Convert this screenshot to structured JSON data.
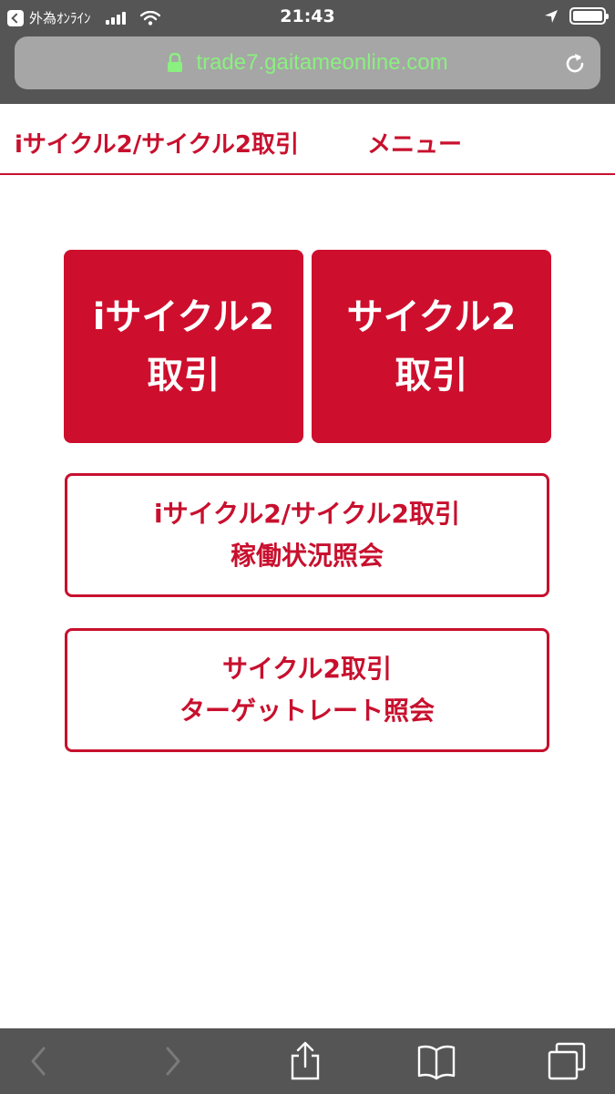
{
  "status_bar": {
    "carrier": "外為ｵﾝﾗｲﾝ",
    "time": "21:43"
  },
  "browser": {
    "url": "trade7.gaitameonline.com"
  },
  "header": {
    "title": "iサイクル2/サイクル2取引",
    "menu_label": "メニュー"
  },
  "tiles": [
    {
      "line1": "iサイクル2",
      "line2": "取引"
    },
    {
      "line1": "サイクル2",
      "line2": "取引"
    }
  ],
  "buttons": [
    {
      "line1": "iサイクル2/サイクル2取引",
      "line2": "稼働状況照会"
    },
    {
      "line1": "サイクル2取引",
      "line2": "ターゲットレート照会"
    }
  ],
  "colors": {
    "brand": "#ce0e2d",
    "url_text": "#8af07f",
    "chrome": "#555555"
  },
  "icons": {
    "back_app": "back-to-app-icon",
    "location": "location-arrow-icon",
    "lock": "lock-icon",
    "reload": "reload-icon",
    "toolbar": [
      "chevron-left-icon",
      "chevron-right-icon",
      "share-icon",
      "bookmarks-icon",
      "tabs-icon"
    ]
  }
}
